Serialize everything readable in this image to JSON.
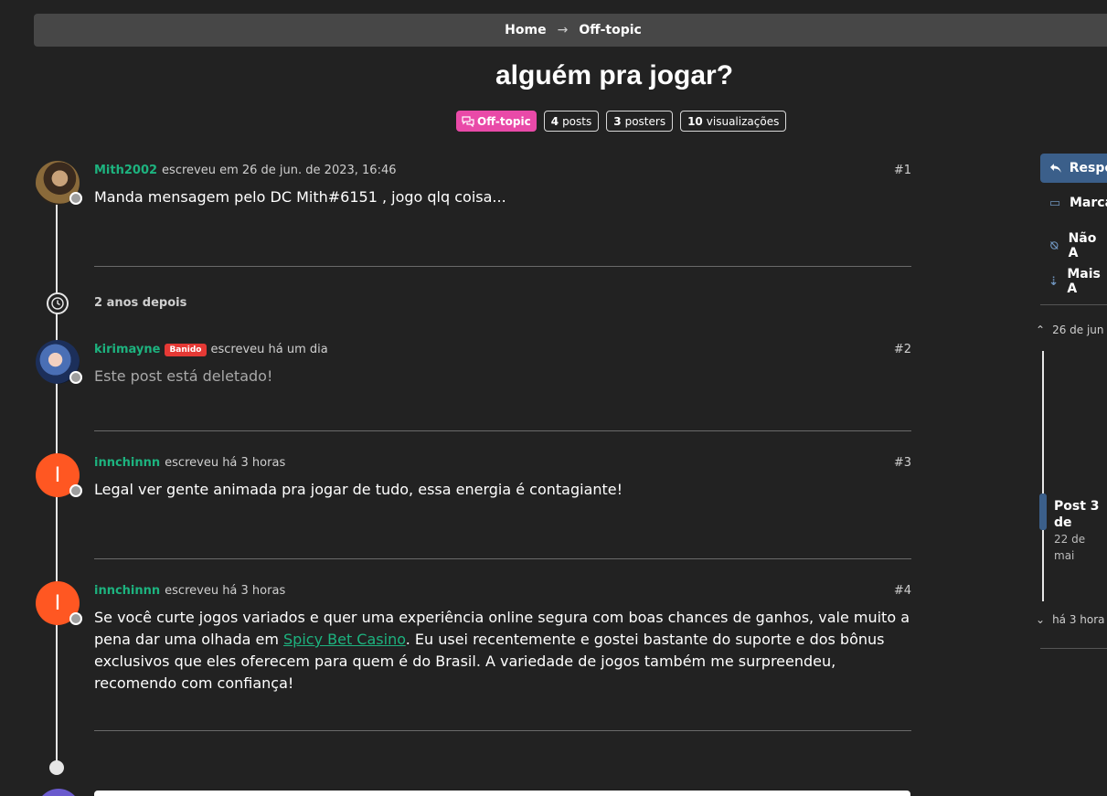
{
  "breadcrumb": {
    "home": "Home",
    "separator": "→",
    "current": "Off-topic"
  },
  "topic": {
    "title": "alguém pra jogar?",
    "category": "Off-topic",
    "posts_count": "4",
    "posts_label": "posts",
    "posters_count": "3",
    "posters_label": "posters",
    "views_count": "10",
    "views_label": "visualizações"
  },
  "posts": [
    {
      "user": "Mith2002",
      "meta": "escreveu em 26 de jun. de 2023, 16:46",
      "index": "#1",
      "body": "Manda mensagem pelo DC Mith#6151 , jogo qlq coisa..."
    },
    {
      "user": "kirimayne",
      "badge": "Banido",
      "meta": "escreveu há um dia",
      "index": "#2",
      "body": "Este post está deletado!"
    },
    {
      "user": "innchinnn",
      "avatar_letter": "I",
      "meta": "escreveu há 3 horas",
      "index": "#3",
      "body": "Legal ver gente animada pra jogar de tudo, essa energia é contagiante!"
    },
    {
      "user": "innchinnn",
      "avatar_letter": "I",
      "meta": "escreveu há 3 horas",
      "index": "#4",
      "body_before": "Se você curte jogos variados e quer uma experiência online segura com boas chances de ganhos, vale muito a pena dar uma olhada em ",
      "link": "Spicy Bet Casino",
      "body_after": ". Eu usei recentemente e gostei bastante do suporte e dos bônus exclusivos que eles oferecem para quem é do Brasil. A variedade de jogos também me surpreendeu, recomendo com confiança!"
    }
  ],
  "timeline_gap": "2 anos depois",
  "sidebar": {
    "reply": "Respo",
    "mark": "Marca",
    "notify": "Não A",
    "sort": "Mais A",
    "scrub_top": "26 de jun",
    "scrub_post": "Post 3 de",
    "scrub_date": "22 de mai",
    "scrub_bottom": "há 3 hora"
  },
  "colors": {
    "accent_green": "#1db37f",
    "category_pink": "#e94aa8",
    "banned_red": "#e53935",
    "avatar_orange": "#ff5722",
    "reply_blue": "#3b5f8a"
  }
}
